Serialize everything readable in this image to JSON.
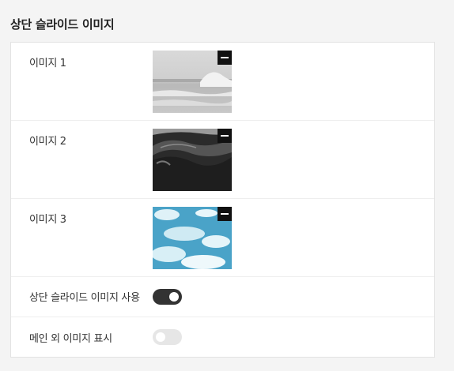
{
  "section": {
    "title": "상단 슬라이드 이미지"
  },
  "images": [
    {
      "label": "이미지 1",
      "image_icon": "sea-waves-photo"
    },
    {
      "label": "이미지 2",
      "image_icon": "dark-ocean-wave-photo"
    },
    {
      "label": "이미지 3",
      "image_icon": "blue-sky-clouds-photo"
    }
  ],
  "remove_icon": "minus-icon",
  "settings": {
    "slide_enabled_label": "상단 슬라이드 이미지 사용",
    "slide_enabled": true,
    "show_outside_main_label": "메인 외 이미지 표시",
    "show_outside_main": false
  },
  "colors": {
    "toggle_on": "#333333",
    "toggle_off": "#e6e6e6",
    "remove_button": "#111111"
  }
}
